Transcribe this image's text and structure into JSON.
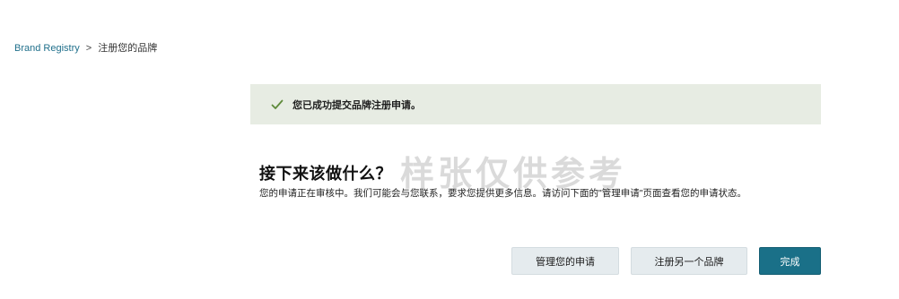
{
  "breadcrumb": {
    "root": "Brand Registry",
    "separator": ">",
    "current": "注册您的品牌"
  },
  "alert": {
    "icon": "check-icon",
    "message": "您已成功提交品牌注册申请。",
    "background": "#e7ece3",
    "icon_color": "#5e8a3a"
  },
  "next_steps": {
    "title": "接下来该做什么？",
    "description": "您的申请正在审核中。我们可能会与您联系，要求您提供更多信息。请访问下面的\"管理申请\"页面查看您的申请状态。"
  },
  "watermark": "样张仅供参考",
  "actions": {
    "manage_label": "管理您的申请",
    "register_another_label": "注册另一个品牌",
    "done_label": "完成"
  },
  "colors": {
    "primary": "#1a7088",
    "link": "#1f6f8b",
    "secondary_button": "#e5ebee"
  }
}
